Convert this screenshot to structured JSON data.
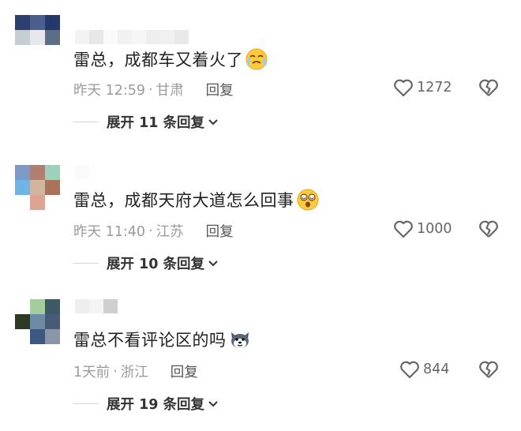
{
  "comments": [
    {
      "text": "雷总，成都车又着火了",
      "emoji_icon": "crying-face-emoji",
      "time": "昨天 12:59",
      "location": "甘肃",
      "reply_label": "回复",
      "likes": "1272",
      "expand_label": "展开 11 条回复",
      "avatar_colors": [
        "#2d3f6c",
        "#4a5e8f",
        "#24386a",
        "#c7ced3",
        "#e6e8ee",
        "#5e6d86",
        "#ffffff",
        "#ffffff",
        "#ffffff"
      ]
    },
    {
      "text": "雷总，成都天府大道怎么回事",
      "emoji_icon": "dizzy-face-emoji",
      "time": "昨天 11:40",
      "location": "江苏",
      "reply_label": "回复",
      "likes": "1000",
      "expand_label": "展开 10 条回复",
      "avatar_colors": [
        "#7d9ac7",
        "#b07f72",
        "#9bd2bd",
        "#6fb4e6",
        "#d3b59e",
        "#a97359",
        "#ffffff",
        "#e0a293",
        "#ffffff"
      ]
    },
    {
      "text": "雷总不看评论区的吗",
      "emoji_icon": "husky-dog-emoji",
      "time": "1天前",
      "location": "浙江",
      "reply_label": "回复",
      "likes": "844",
      "expand_label": "展开 19 条回复",
      "avatar_colors": [
        "#ffffff",
        "#a4cd9e",
        "#3c5a62",
        "#2e3a24",
        "#6f8aa4",
        "#475a76",
        "#ffffff",
        "#3c5880",
        "#8b95a9"
      ]
    }
  ],
  "colors": {
    "text": "#222222",
    "meta": "#9b9b9b",
    "icon": "#666666"
  }
}
